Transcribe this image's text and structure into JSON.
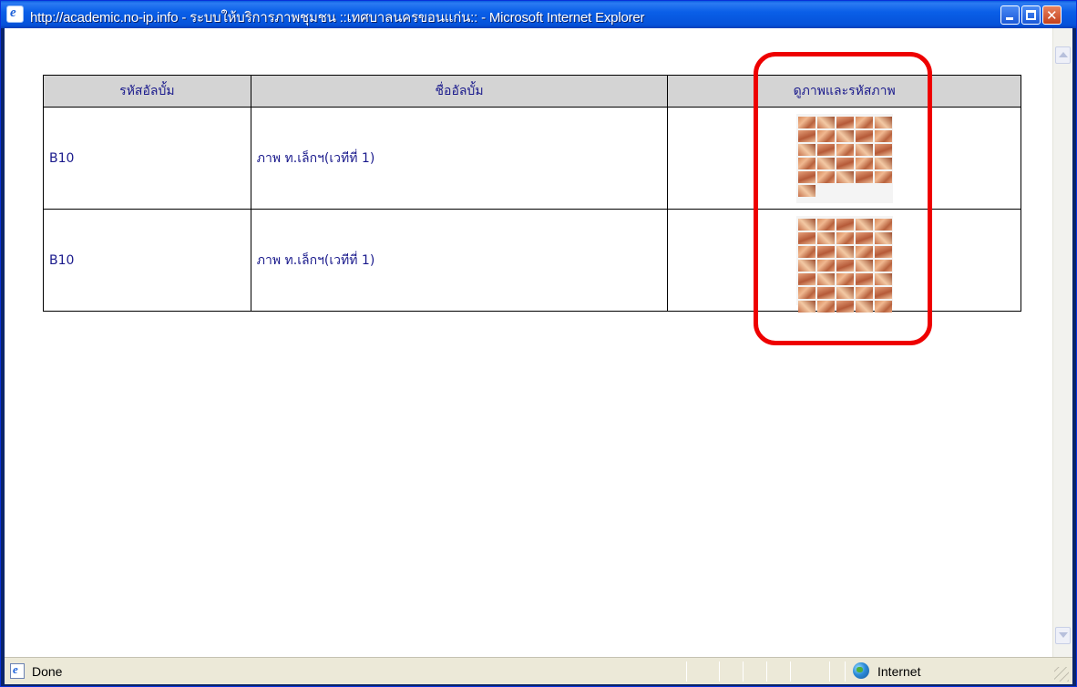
{
  "window": {
    "title": "http://academic.no-ip.info - ระบบให้บริการภาพชุมชน ::เทศบาลนครขอนแก่น:: - Microsoft Internet Explorer",
    "icon": "ie-icon",
    "controls": [
      "minimize-icon",
      "maximize-icon",
      "close-icon"
    ]
  },
  "table": {
    "headers": {
      "code": "รหัสอัลบั้ม",
      "name": "ชื่ออัลบั้ม",
      "thumb": "ดูภาพและรหัสภาพ"
    },
    "rows": [
      {
        "code": "B10",
        "name": "ภาพ ท.เล็กฯ(เวทีที่ 1)",
        "thumb": "album-thumbnail"
      },
      {
        "code": "B10",
        "name": "ภาพ ท.เล็กฯ(เวทีที่ 1)",
        "thumb": "album-thumbnail"
      }
    ]
  },
  "annotation": {
    "color": "#ee0000"
  },
  "status_bar": {
    "text": "Done",
    "zone": "Internet",
    "zone_icon": "globe-icon"
  },
  "colors": {
    "title_bar": "#0552d9",
    "header_bg": "#d4d4d4",
    "link_text": "#1a1a8c",
    "status_bg": "#ece9d8"
  }
}
